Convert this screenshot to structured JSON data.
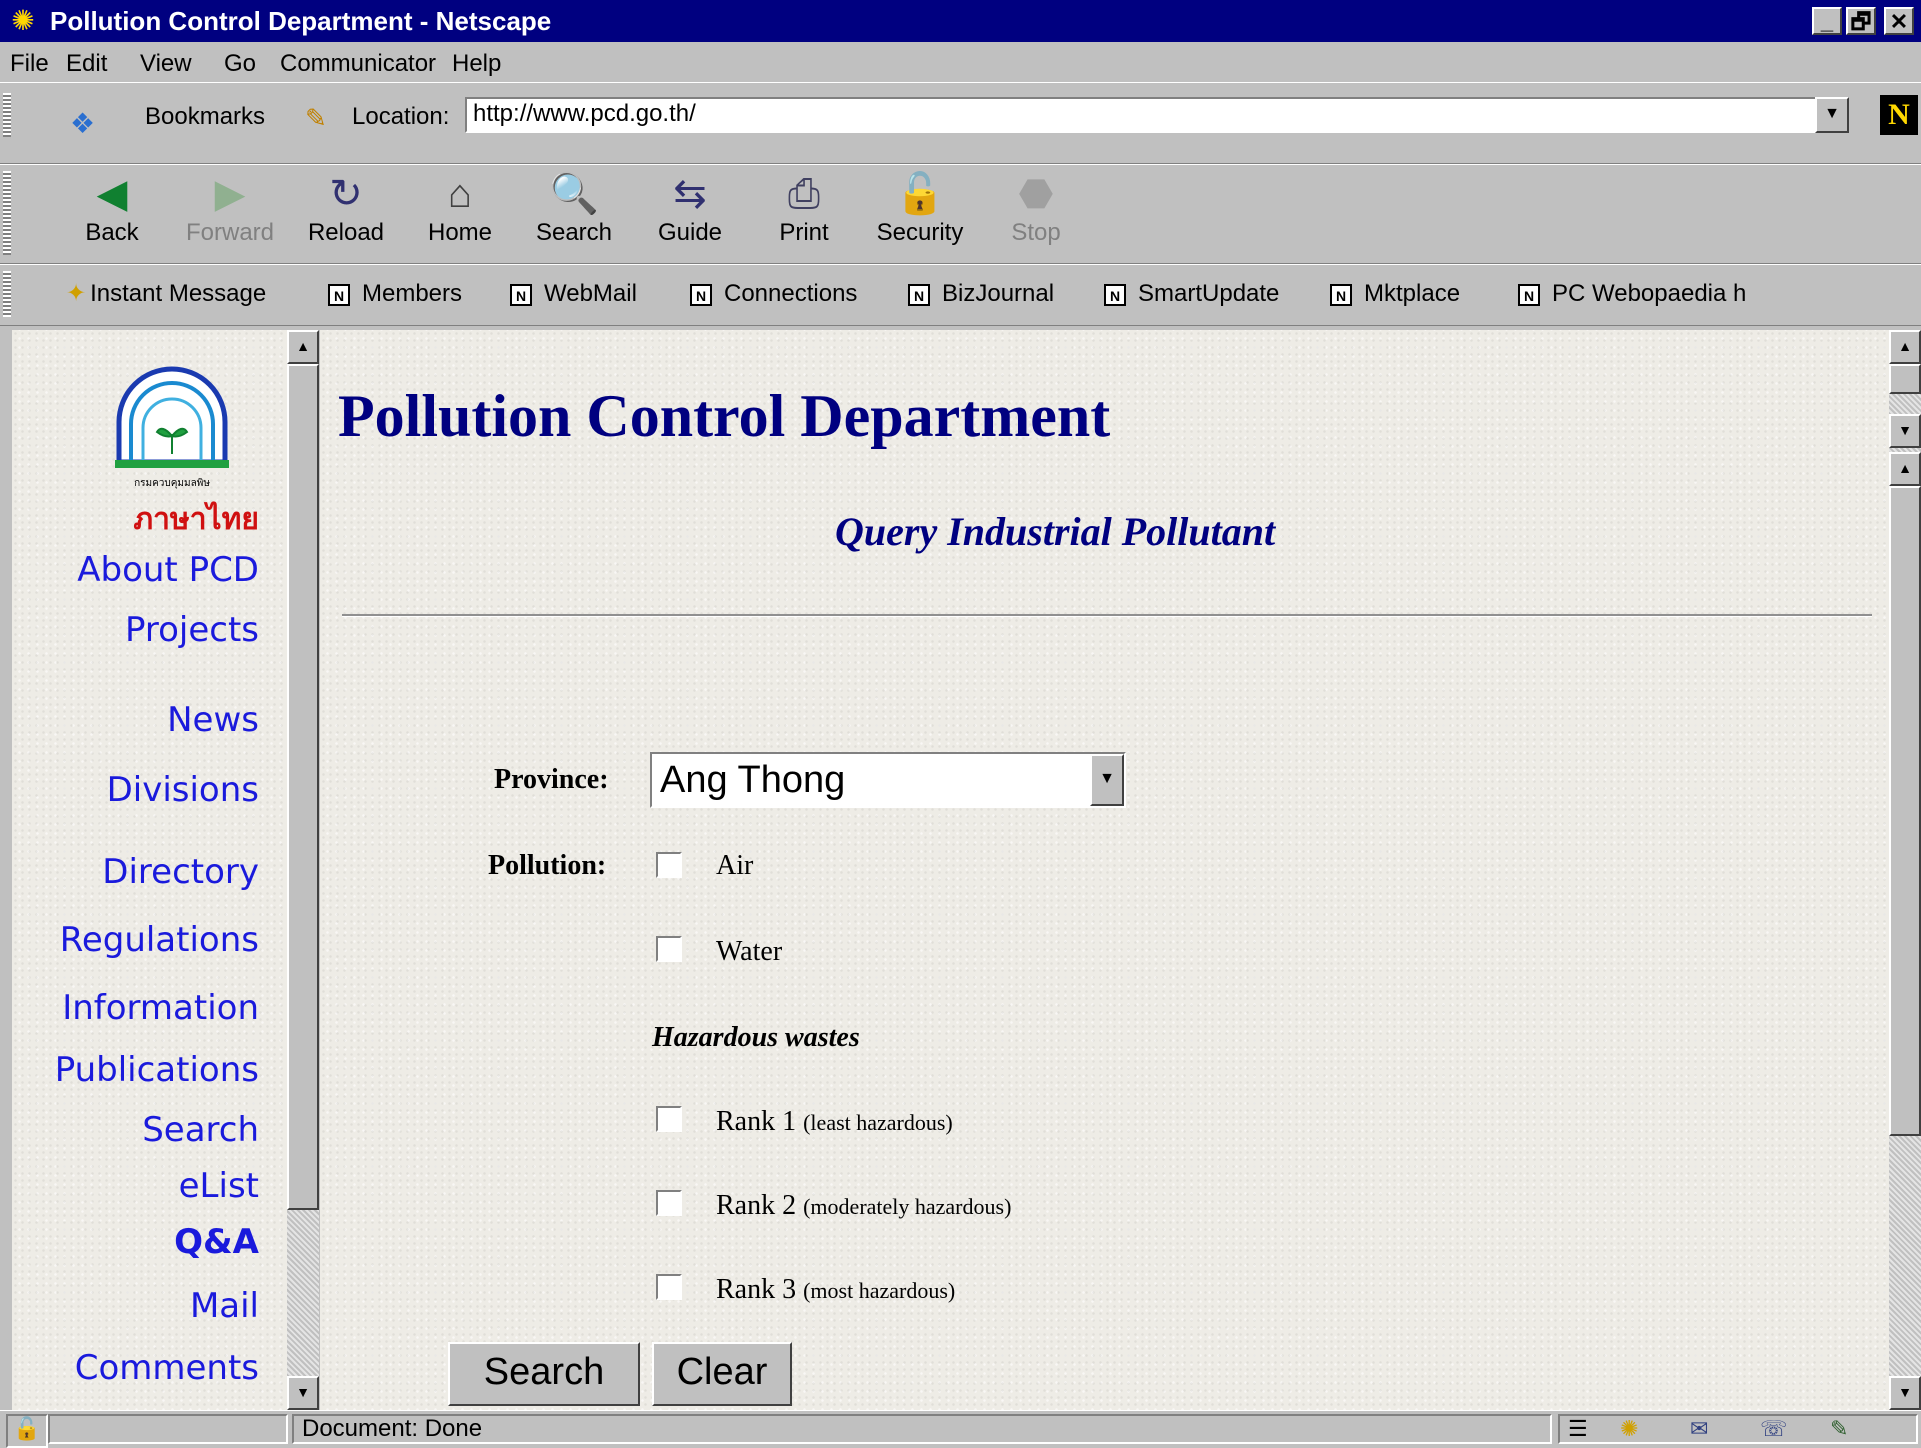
{
  "window": {
    "title": "Pollution Control Department - Netscape",
    "buttons": {
      "minimize": "_",
      "maximize": "🗗",
      "close": "✕"
    }
  },
  "menu": [
    "File",
    "Edit",
    "View",
    "Go",
    "Communicator",
    "Help"
  ],
  "location_bar": {
    "bookmarks_label": "Bookmarks",
    "location_label": "Location:",
    "url": "http://www.pcd.go.th/"
  },
  "nav_toolbar": [
    {
      "label": "Back",
      "icon": "◀",
      "enabled": true
    },
    {
      "label": "Forward",
      "icon": "▶",
      "enabled": false
    },
    {
      "label": "Reload",
      "icon": "↻",
      "enabled": true
    },
    {
      "label": "Home",
      "icon": "⌂",
      "enabled": true
    },
    {
      "label": "Search",
      "icon": "🔍",
      "enabled": true
    },
    {
      "label": "Guide",
      "icon": "⇆",
      "enabled": true
    },
    {
      "label": "Print",
      "icon": "⎙",
      "enabled": true
    },
    {
      "label": "Security",
      "icon": "🔓",
      "enabled": true
    },
    {
      "label": "Stop",
      "icon": "⬣",
      "enabled": false
    }
  ],
  "personal_toolbar": [
    "Instant Message",
    "Members",
    "WebMail",
    "Connections",
    "BizJournal",
    "SmartUpdate",
    "Mktplace",
    "PC Webopaedia h"
  ],
  "sidebar": {
    "logo_text": "กรมควบคุมมลพิษ",
    "items": [
      "ภาษาไทย",
      "About PCD",
      "Projects",
      "News",
      "Divisions",
      "Directory",
      "Regulations",
      "Information",
      "Publications",
      "Search",
      "eList",
      "Q&A",
      "Mail",
      "Comments"
    ]
  },
  "main": {
    "title": "Pollution Control Department",
    "subtitle": "Query Industrial Pollutant",
    "province_label": "Province:",
    "province_value": "Ang Thong",
    "pollution_label": "Pollution:",
    "options": {
      "air": "Air",
      "water": "Water",
      "hazardous_heading": "Hazardous wastes",
      "rank1": "Rank 1",
      "rank1_note": "(least hazardous)",
      "rank2": "Rank 2",
      "rank2_note": "(moderately hazardous)",
      "rank3": "Rank 3",
      "rank3_note": "(most hazardous)"
    },
    "search_button": "Search",
    "clear_button": "Clear"
  },
  "status": {
    "text": "Document: Done"
  },
  "colors": {
    "title_bar": "#000080",
    "heading": "#000080",
    "sidebar_link": "#1a1adc",
    "thai_link": "#d01010"
  }
}
